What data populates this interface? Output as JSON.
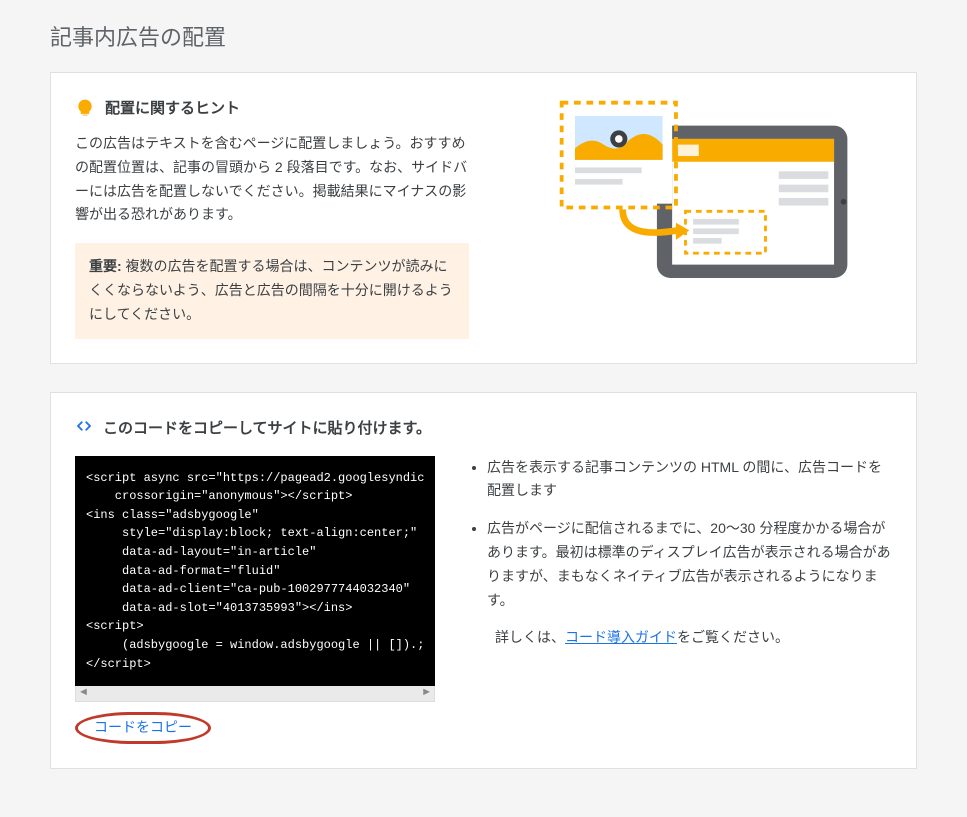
{
  "page": {
    "title": "記事内広告の配置"
  },
  "hint": {
    "header": "配置に関するヒント",
    "body": "この広告はテキストを含むページに配置しましょう。おすすめの配置位置は、記事の冒頭から 2 段落目です。なお、サイドバーには広告を配置しないでください。掲載結果にマイナスの影響が出る恐れがあります。",
    "notice_label": "重要:",
    "notice_body": " 複数の広告を配置する場合は、コンテンツが読みにくくならないよう、広告と広告の間隔を十分に開けるようにしてください。"
  },
  "code": {
    "header": "このコードをコピーしてサイトに貼り付けます。",
    "snippet": "<script async src=\"https://pagead2.googlesyndic\n    crossorigin=\"anonymous\"></script>\n<ins class=\"adsbygoogle\"\n     style=\"display:block; text-align:center;\"\n     data-ad-layout=\"in-article\"\n     data-ad-format=\"fluid\"\n     data-ad-client=\"ca-pub-1002977744032340\"\n     data-ad-slot=\"4013735993\"></ins>\n<script>\n     (adsbygoogle = window.adsbygoogle || []).;\n</script>",
    "copy_label": "コードをコピー",
    "bullets": [
      "広告を表示する記事コンテンツの HTML の間に、広告コードを配置します",
      "広告がページに配信されるまでに、20～30 分程度かかる場合があります。最初は標準のディスプレイ広告が表示される場合がありますが、まもなくネイティブ広告が表示されるようになります。"
    ],
    "detail_prefix": "詳しくは、",
    "detail_link": "コード導入ガイド",
    "detail_suffix": "をご覧ください。"
  }
}
